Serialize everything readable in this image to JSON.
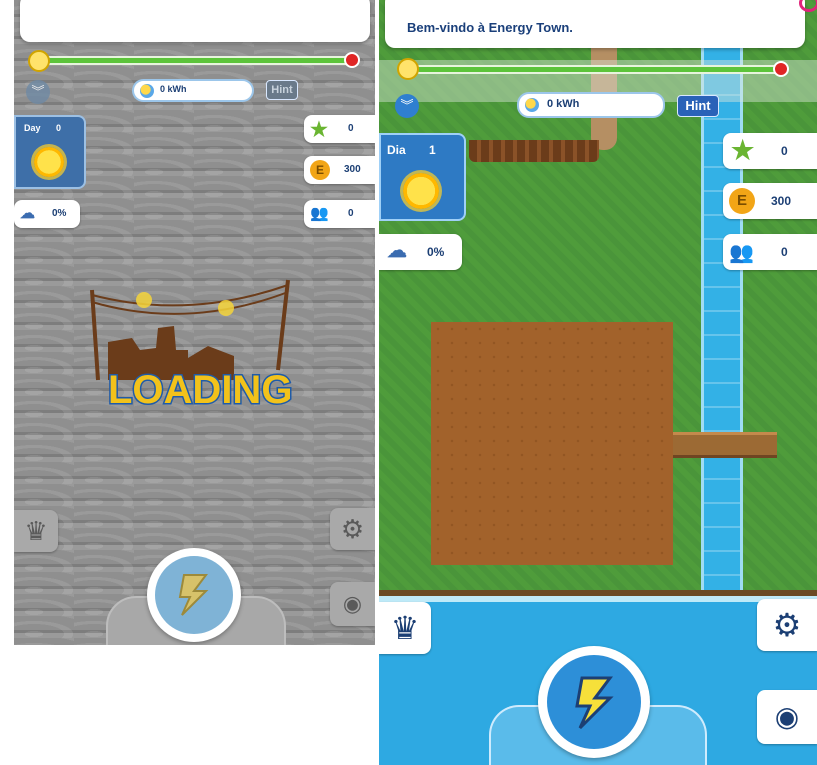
{
  "left_screen": {
    "kwh": "0 kWh",
    "hint": "Hint",
    "day_label": "Day",
    "day_number": "0",
    "weather_percent": "0%",
    "stars": "0",
    "coins": "300",
    "population": "0",
    "loading_text": "LOADING",
    "energy_progress": 0
  },
  "right_screen": {
    "welcome_message": "Bem-vindo à Energy Town.",
    "kwh": "0 kWh",
    "hint": "Hint",
    "day_label": "Dia",
    "day_number": "1",
    "weather_percent": "0%",
    "stars": "0",
    "coins": "300",
    "population": "0",
    "energy_progress": 0
  },
  "icons": {
    "bulb": "lightbulb-icon",
    "collapse": "chevron-down-icon",
    "energy": "energy-orb-icon",
    "sun": "sun-icon",
    "weather": "rain-cloud-icon",
    "star": "star-icon",
    "coin": "coin-icon",
    "people": "people-icon",
    "crown": "crown-icon",
    "settings": "gear-icon",
    "eye": "eye-icon",
    "bolt": "lightning-bolt-icon"
  },
  "colors": {
    "accent_blue": "#2e7ac4",
    "progress_green": "#5cc43a",
    "loading_yellow": "#f2c21b",
    "river_blue": "#33b1e6"
  }
}
